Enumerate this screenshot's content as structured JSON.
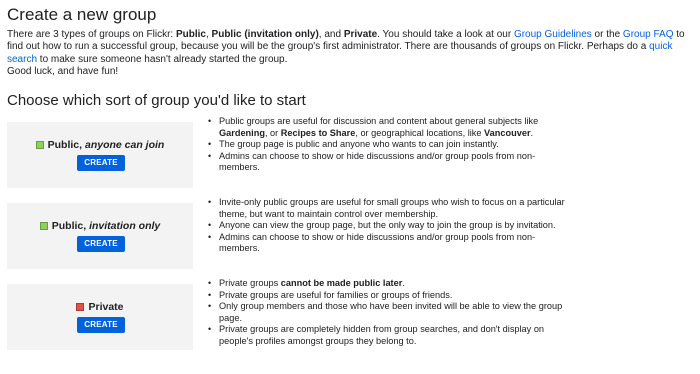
{
  "page": {
    "title": "Create a new group",
    "intro": {
      "t1": "There are 3 types of groups on Flickr: ",
      "public": "Public",
      "t2": ", ",
      "public_invite": "Public (invitation only)",
      "t3": ", and ",
      "private": "Private",
      "t4": ". You should take a look at our ",
      "link_guidelines": "Group Guidelines",
      "t5": " or the ",
      "link_faq": "Group FAQ",
      "t6": " to find out how to run a successful group, because you will be the group's first administrator. There are thousands of groups on Flickr. Perhaps do a ",
      "link_search": "quick search",
      "t7": " to make sure someone hasn't already started the group.",
      "goodluck": "Good luck, and have fun!"
    },
    "subtitle": "Choose which sort of group you'd like to start"
  },
  "colors": {
    "link": "#0063dc",
    "button": "#0063dc",
    "green": "#8fd15d",
    "red": "#e2504a",
    "box": "#f3f3f3"
  },
  "groups": [
    {
      "name": "Public, ",
      "name_italic": "anyone can join",
      "icon": "green-square-icon",
      "button": "CREATE",
      "bullets": {
        "b1a": "Public groups are useful for discussion and content about general subjects like ",
        "b1b": "Gardening",
        "b1c": ", or ",
        "b1d": "Recipes to Share",
        "b1e": ", or geographical locations, like ",
        "b1f": "Vancouver",
        "b1g": ".",
        "b2": "The group page is public and anyone who wants to can join instantly.",
        "b3": "Admins can choose to show or hide discussions and/or group pools from non-members."
      }
    },
    {
      "name": "Public, ",
      "name_italic": "invitation only",
      "icon": "green-square-icon",
      "button": "CREATE",
      "bullets": {
        "b1": "Invite-only public groups are useful for small groups who wish to focus on a particular theme, but want to maintain control over membership.",
        "b2": "Anyone can view the group page, but the only way to join the group is by invitation.",
        "b3": "Admins can choose to show or hide discussions and/or group pools from non-members."
      }
    },
    {
      "name": "Private",
      "icon": "red-square-icon",
      "button": "CREATE",
      "bullets": {
        "b1a": "Private groups ",
        "b1b": "cannot be made public later",
        "b1c": ".",
        "b2": "Private groups are useful for families or groups of friends.",
        "b3": "Only group members and those who have been invited will be able to view the group page.",
        "b4": "Private groups are completely hidden from group searches, and don't display on people's profiles amongst groups they belong to."
      }
    }
  ]
}
